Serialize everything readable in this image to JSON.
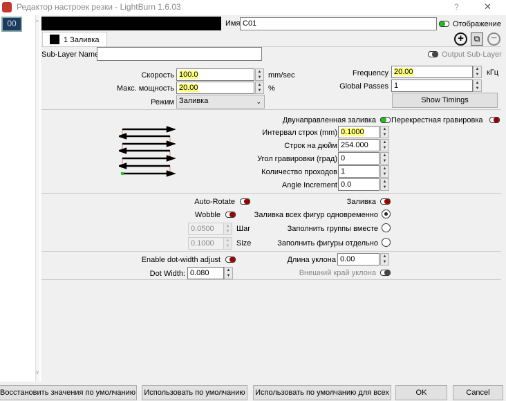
{
  "window": {
    "title": "Редактор настроек резки - LightBurn 1.6.03",
    "help": "?",
    "close": "✕"
  },
  "layer_list": {
    "items": [
      "00"
    ]
  },
  "header": {
    "name_label": "Имя",
    "name_value": "C01",
    "display_label": "Отображение",
    "layer_color": "#000000"
  },
  "tabs": [
    {
      "label": "1 Заливка"
    }
  ],
  "sublayer": {
    "name_label": "Sub-Layer Name",
    "name_value": "",
    "output_label": "Output Sub-Layer"
  },
  "main": {
    "speed_label": "Скорость",
    "speed_value": "100.0",
    "speed_unit": "mm/sec",
    "power_label": "Макс. мощность",
    "power_value": "20.00",
    "power_unit": "%",
    "mode_label": "Режим",
    "mode_value": "Заливка",
    "freq_label": "Frequency",
    "freq_value": "20.00",
    "freq_unit": "кГц",
    "passes_label": "Global Passes",
    "passes_value": "1",
    "show_timings": "Show Timings"
  },
  "fill": {
    "bidir_label": "Двунаправленная заливка",
    "cross_label": "Перекрестная гравировка",
    "interval_label": "Интервал строк (mm)",
    "interval_value": "0.1000",
    "lpi_label": "Строк на дюйм",
    "lpi_value": "254.000",
    "angle_label": "Угол гравировки (град)",
    "angle_value": "0",
    "count_label": "Количество проходов",
    "count_value": "1",
    "inc_label": "Angle Increment",
    "inc_value": "0.0"
  },
  "options": {
    "autorotate_label": "Auto-Rotate",
    "wobble_label": "Wobble",
    "step_value": "0.0500",
    "step_label": "Шаг",
    "size_value": "0.1000",
    "size_label": "Size",
    "fill_label": "Заливка",
    "radio": [
      {
        "label": "Заливка всех фигур одновременно",
        "checked": true
      },
      {
        "label": "Заполнить группы вместе",
        "checked": false
      },
      {
        "label": "Заполнить фигуры отдельно",
        "checked": false
      }
    ]
  },
  "dot": {
    "enable_label": "Enable dot-width adjust",
    "width_label": "Dot Width:",
    "width_value": "0.080",
    "ramp_label": "Длина уклона",
    "ramp_value": "0.00",
    "outer_label": "Внешний край уклона"
  },
  "footer": {
    "restore": "Восстановить значения по умолчанию",
    "use_default": "Использовать по умолчанию",
    "use_default_all": "Использовать по умолчанию для всех",
    "ok": "OK",
    "cancel": "Cancel"
  }
}
